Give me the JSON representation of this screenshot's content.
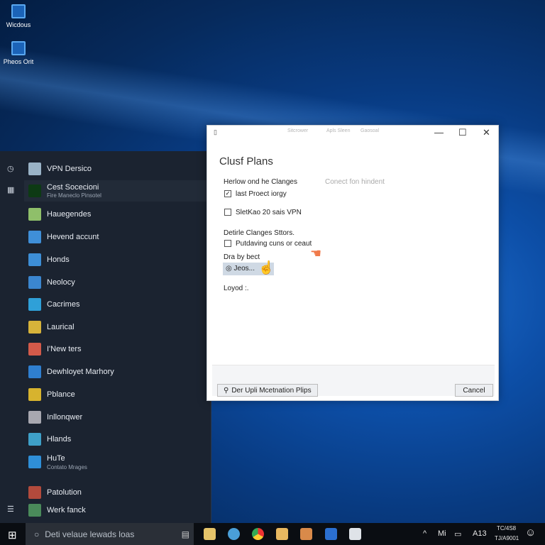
{
  "desktop": {
    "icons": [
      {
        "label": "Wicdous"
      },
      {
        "label": "Pheos Orit"
      }
    ]
  },
  "start_menu": {
    "items": [
      {
        "label": "VPN Dersico",
        "color": "#9ab3c7"
      },
      {
        "label": "Cest Socecioni",
        "sub": "Fire Maneclo Pinsotel",
        "color": "#0d3a14",
        "selected": true
      },
      {
        "label": "Hauegendes",
        "color": "#8fbf6a"
      },
      {
        "label": "Hevend accunt",
        "color": "#3f8fd8"
      },
      {
        "label": "Honds",
        "color": "#3d8ed6"
      },
      {
        "label": "Neolocy",
        "color": "#3b86cf"
      },
      {
        "label": "Cacrimes",
        "color": "#2fa0d8"
      },
      {
        "label": "Laurical",
        "color": "#d7b33a"
      },
      {
        "label": "I'New ters",
        "color": "#d35a4a"
      },
      {
        "label": "Dewhloyet Marhory",
        "color": "#2f7fd0"
      },
      {
        "label": "Pblance",
        "color": "#d7b32e"
      },
      {
        "label": "Inllonqwer",
        "color": "#a8a8b0"
      },
      {
        "label": "Hlands",
        "color": "#3ea0c8"
      },
      {
        "label": "HuTe",
        "sub": "Contato Mrages",
        "color": "#2f8fd8"
      },
      {
        "label": "Patolution",
        "color": "#b24a3c"
      },
      {
        "label": "Werk fanck",
        "color": "#4a8a5a"
      }
    ]
  },
  "taskbar": {
    "search_placeholder": "Deti velaue lewads loas",
    "tray": {
      "lang": "Mi",
      "status": "A13",
      "time": "TC/4S8",
      "date": "TJ/A9001"
    }
  },
  "dialog": {
    "titlebar": [
      "Sitcrower",
      "Apls Sleen",
      "Gaosoal"
    ],
    "title": "Clusf Plans",
    "section1": "Herlow ond he Clanges",
    "hint": "Conect fon hindent",
    "options": [
      {
        "label": "last Proect iorgy",
        "checked": true
      },
      {
        "label": "SletKao 20 sais VPN",
        "checked": false
      }
    ],
    "section2": "Detirle Clanges Sttors.",
    "option3": {
      "label": "Putdaving cuns or ceaut",
      "checked": false
    },
    "field_label": "Dra by bect",
    "field_value": "Jeos...",
    "loading": "Loyod :.",
    "footer": {
      "left_button": "Der Upli Mcetnation Plips",
      "cancel": "Cancel"
    }
  }
}
